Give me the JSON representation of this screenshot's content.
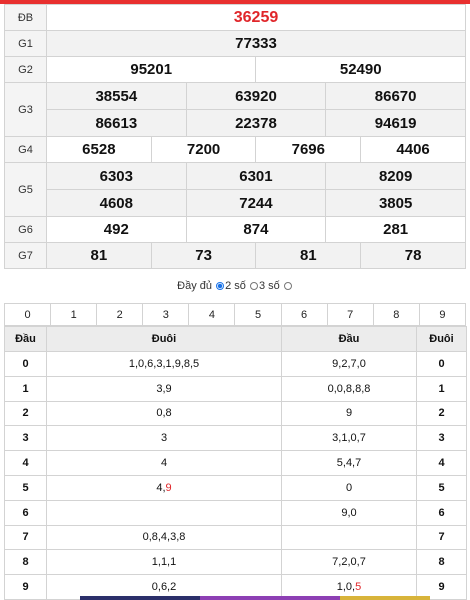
{
  "results": {
    "db": {
      "label": "ĐB",
      "values": [
        "36259"
      ]
    },
    "g1": {
      "label": "G1",
      "values": [
        "77333"
      ]
    },
    "g2": {
      "label": "G2",
      "values": [
        "95201",
        "52490"
      ]
    },
    "g3": {
      "label": "G3",
      "values": [
        "38554",
        "63920",
        "86670",
        "86613",
        "22378",
        "94619"
      ]
    },
    "g4": {
      "label": "G4",
      "values": [
        "6528",
        "7200",
        "7696",
        "4406"
      ]
    },
    "g5": {
      "label": "G5",
      "values": [
        "6303",
        "6301",
        "8209",
        "4608",
        "7244",
        "3805"
      ]
    },
    "g6": {
      "label": "G6",
      "values": [
        "492",
        "874",
        "281"
      ]
    },
    "g7": {
      "label": "G7",
      "values": [
        "81",
        "73",
        "81",
        "78"
      ]
    }
  },
  "options": {
    "full": "Đầy đủ",
    "two": "2 số",
    "three": "3 số",
    "selected": "two"
  },
  "digits": [
    "0",
    "1",
    "2",
    "3",
    "4",
    "5",
    "6",
    "7",
    "8",
    "9"
  ],
  "loto": {
    "headers": [
      "Đầu",
      "Đuôi",
      "Đầu",
      "Đuôi"
    ],
    "rows": [
      {
        "head": "0",
        "tail": "1,0,6,3,1,9,8,5",
        "tail_hl": "",
        "head2": "9,2,7,0",
        "head2_hl": "",
        "tail2": "0"
      },
      {
        "head": "1",
        "tail": "3,9",
        "tail_hl": "",
        "head2": "0,0,8,8,8",
        "head2_hl": "",
        "tail2": "1"
      },
      {
        "head": "2",
        "tail": "0,8",
        "tail_hl": "",
        "head2": "9",
        "head2_hl": "",
        "tail2": "2"
      },
      {
        "head": "3",
        "tail": "3",
        "tail_hl": "",
        "head2": "3,1,0,7",
        "head2_hl": "",
        "tail2": "3"
      },
      {
        "head": "4",
        "tail": "4",
        "tail_hl": "",
        "head2": "5,4,7",
        "head2_hl": "",
        "tail2": "4"
      },
      {
        "head": "5",
        "tail": "4,",
        "tail_hl": "9",
        "head2": "0",
        "head2_hl": "",
        "tail2": "5"
      },
      {
        "head": "6",
        "tail": "",
        "tail_hl": "",
        "head2": "9,0",
        "head2_hl": "",
        "tail2": "6"
      },
      {
        "head": "7",
        "tail": "0,8,4,3,8",
        "tail_hl": "",
        "head2": "",
        "head2_hl": "",
        "tail2": "7"
      },
      {
        "head": "8",
        "tail": "1,1,1",
        "tail_hl": "",
        "head2": "7,2,0,7",
        "head2_hl": "",
        "tail2": "8"
      },
      {
        "head": "9",
        "tail": "0,6,2",
        "tail_hl": "",
        "head2": "1,0,",
        "head2_hl": "5",
        "tail2": "9"
      }
    ]
  },
  "colors": {
    "accent": "#e0262a",
    "radio": "#1a73e8"
  }
}
